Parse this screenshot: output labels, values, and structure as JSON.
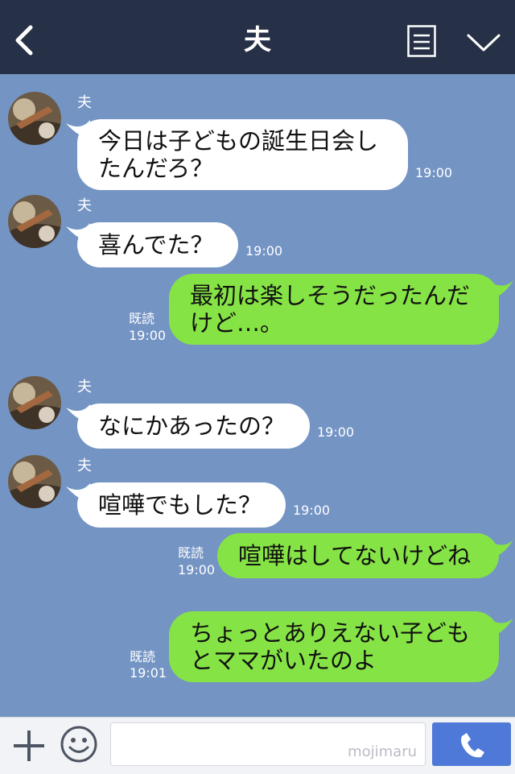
{
  "header": {
    "title": "夫",
    "back_icon": "chevron-left-icon",
    "menu_icon": "notes-icon",
    "collapse_icon": "chevron-down-icon"
  },
  "messages": [
    {
      "side": "left",
      "sender": "夫",
      "text": "今日は子どもの誕生日会し\nたんだろ？",
      "time": "19:00"
    },
    {
      "side": "left",
      "sender": "夫",
      "text": "喜んでた？",
      "time": "19:00"
    },
    {
      "side": "right",
      "read": "既読",
      "text": "最初は楽しそうだったんだ\nけど…。",
      "time": "19:00"
    },
    {
      "side": "left",
      "sender": "夫",
      "text": "なにかあったの？",
      "time": "19:00"
    },
    {
      "side": "left",
      "sender": "夫",
      "text": "喧嘩でもした？",
      "time": "19:00"
    },
    {
      "side": "right",
      "read": "既読",
      "text": "喧嘩はしてないけどね",
      "time": "19:00"
    },
    {
      "side": "right",
      "read": "既読",
      "text": "ちょっとありえない子ども\nとママがいたのよ",
      "time": "19:01"
    }
  ],
  "input_bar": {
    "plus_icon": "plus-icon",
    "emoji_icon": "smiley-icon",
    "watermark": "mojimaru",
    "call_icon": "phone-icon"
  },
  "colors": {
    "header": "#263147",
    "chat_bg": "#7494c4",
    "right_bubble": "#86e345",
    "left_bubble": "#ffffff",
    "call_button": "#4f79d8"
  }
}
